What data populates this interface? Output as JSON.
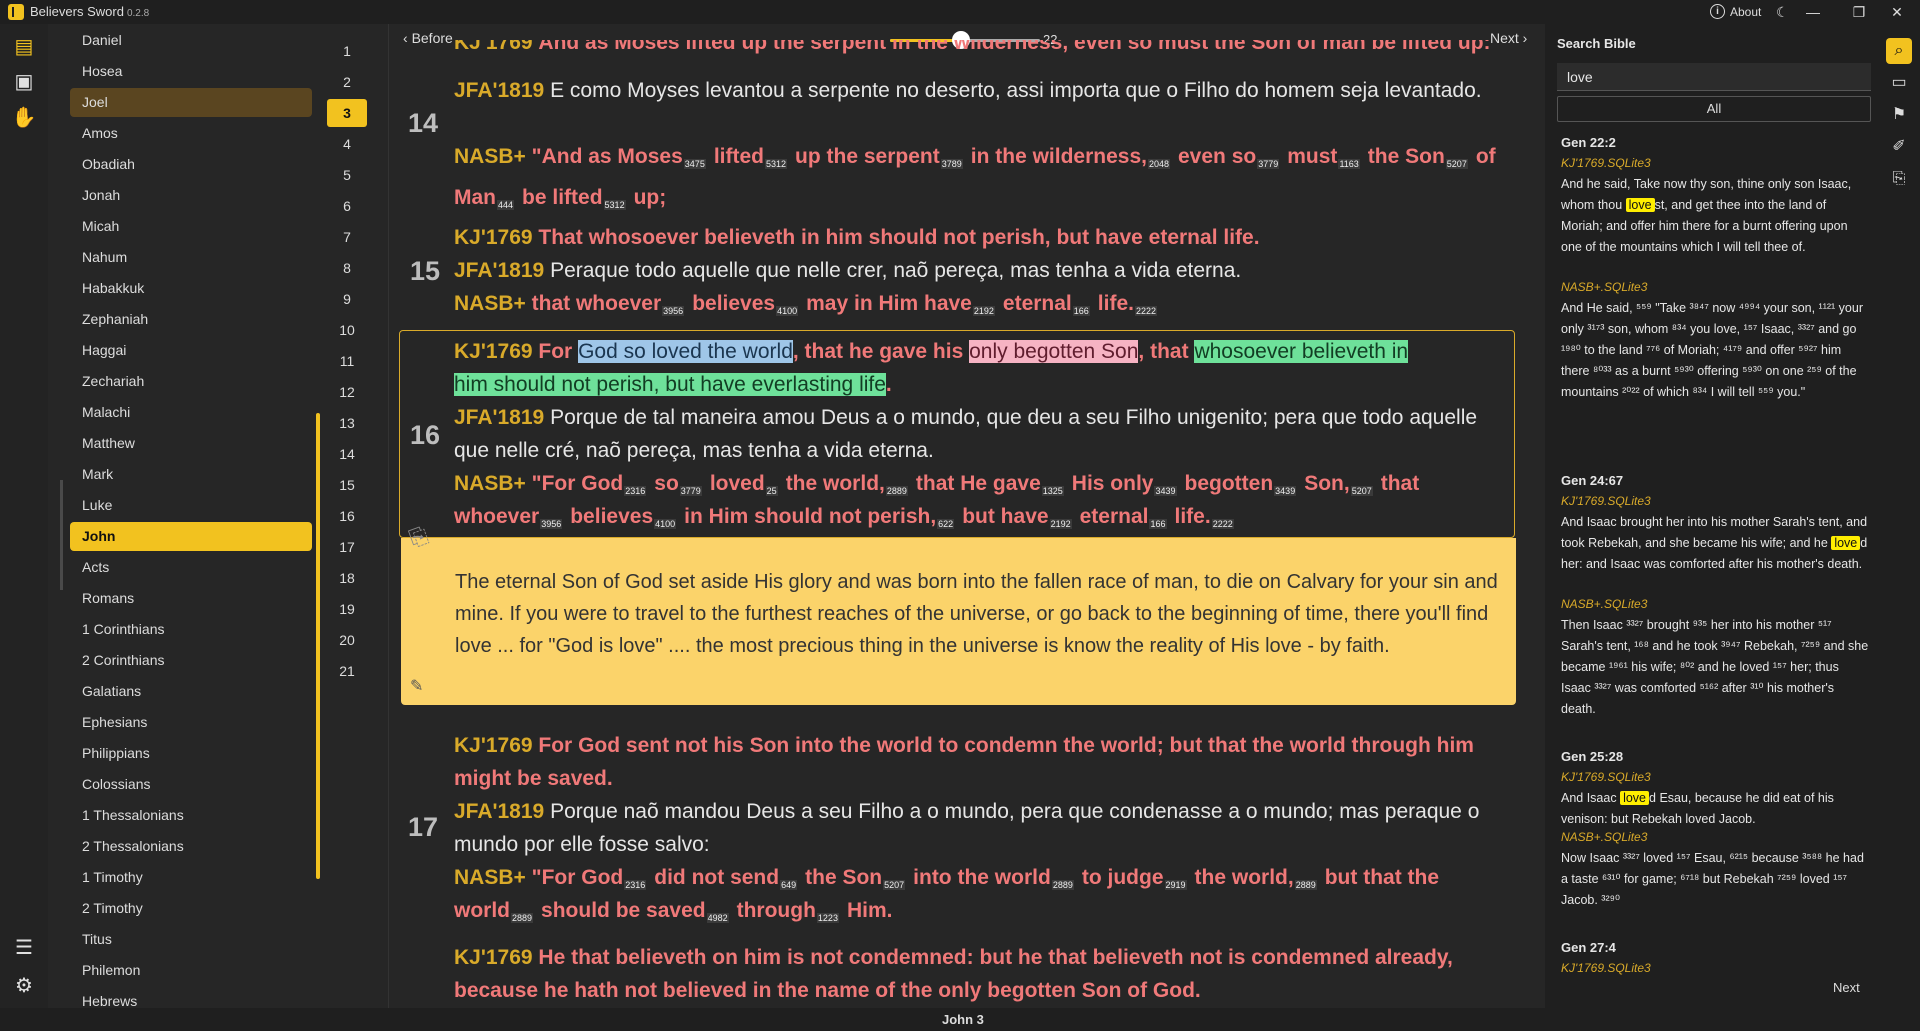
{
  "app": {
    "title": "Believers Sword",
    "version": "0.2.8",
    "about": "About",
    "window_buttons": [
      "—",
      "❐",
      "✕"
    ]
  },
  "books": [
    "Daniel",
    "Hosea",
    "Joel",
    "Amos",
    "Obadiah",
    "Jonah",
    "Micah",
    "Nahum",
    "Habakkuk",
    "Zephaniah",
    "Haggai",
    "Zechariah",
    "Malachi",
    "Matthew",
    "Mark",
    "Luke",
    "John",
    "Acts",
    "Romans",
    "1 Corinthians",
    "2 Corinthians",
    "Galatians",
    "Ephesians",
    "Philippians",
    "Colossians",
    "1 Thessalonians",
    "2 Thessalonians",
    "1 Timothy",
    "2 Timothy",
    "Titus",
    "Philemon",
    "Hebrews"
  ],
  "selected_book": "John",
  "hover_book": "Joel",
  "chapters": [
    "1",
    "2",
    "3",
    "4",
    "5",
    "6",
    "7",
    "8",
    "9",
    "10",
    "11",
    "12",
    "13",
    "14",
    "15",
    "16",
    "17",
    "18",
    "19",
    "20",
    "21"
  ],
  "selected_chapter": "3",
  "nav": {
    "before": "Before",
    "next": "Next",
    "font_size": "22",
    "font_size_level": 0.47
  },
  "verses": {
    "v14": {
      "num": "14",
      "kj_tag": "KJ'1769",
      "kj": "And as Moses lifted up the serpent in the wilderness, even so must the Son of man be lifted up:",
      "jfa_tag": "JFA'1819",
      "jfa": "E como Moyses levantou a serpente no deserto, assi importa que o Filho do homem seja levantado.",
      "nasb_tag": "NASB+",
      "nasb": [
        [
          "\"And as Moses",
          "3475"
        ],
        [
          "lifted",
          "5312"
        ],
        [
          "up the serpent",
          "3789"
        ],
        [
          "in the wilderness,",
          "2048"
        ],
        [
          "even so",
          "3779"
        ],
        [
          "must",
          "1163"
        ],
        [
          "the Son",
          "5207"
        ],
        [
          "of Man",
          "444"
        ],
        [
          "be lifted",
          "5312"
        ],
        [
          "up;",
          ""
        ]
      ]
    },
    "v15": {
      "num": "15",
      "kj_tag": "KJ'1769",
      "kj": "That whosoever believeth in him should not perish, but have eternal life.",
      "jfa_tag": "JFA'1819",
      "jfa": "Peraque todo aquelle que nelle crer, naõ pereça, mas tenha a vida eterna.",
      "nasb_tag": "NASB+",
      "nasb": [
        [
          "that whoever",
          "3956"
        ],
        [
          "believes",
          "4100"
        ],
        [
          "may in Him have",
          "2192"
        ],
        [
          "eternal",
          "166"
        ],
        [
          "life.",
          "2222"
        ]
      ]
    },
    "v16": {
      "num": "16",
      "kj_tag": "KJ'1769",
      "kj_pre": "For",
      "kj_hl1": "God so loved the world",
      "kj_mid1": ", that he gave his",
      "kj_hl2": "only begotten Son",
      "kj_mid2": ", that",
      "kj_hl3a": "whosoever believeth in",
      "kj_hl3b": "him should not perish, but have everlasting life",
      "kj_end": ".",
      "jfa_tag": "JFA'1819",
      "jfa": "Porque de tal maneira amou Deus a o mundo, que deu a seu Filho unigenito; pera que todo aquelle que nelle cré, naõ pereça, mas tenha a vida eterna.",
      "nasb_tag": "NASB+",
      "nasb_l1": [
        [
          "\"For God",
          "2316"
        ],
        [
          "so",
          "3779"
        ],
        [
          "loved",
          "25"
        ],
        [
          "the world,",
          "2889"
        ],
        [
          "that He gave",
          "1325"
        ],
        [
          "His only",
          "3439"
        ],
        [
          "begotten",
          "3439"
        ],
        [
          "Son,",
          "5207"
        ],
        [
          "that",
          ""
        ]
      ],
      "nasb_l2": [
        [
          "whoever",
          "3956"
        ],
        [
          "believes",
          "4100"
        ],
        [
          "in Him should not perish,",
          "622"
        ],
        [
          "but have",
          "2192"
        ],
        [
          "eternal",
          "166"
        ],
        [
          "life.",
          "2222"
        ]
      ],
      "note": "The eternal Son of God set aside His glory and was born into the fallen race of man, to die on Calvary for your sin and mine. If you were to travel to the furthest reaches of the universe, or go back to the beginning of time, there you'll find love ... for \"God is love\" .... the most precious thing in the universe is know the reality of His love - by faith."
    },
    "v17": {
      "num": "17",
      "kj_tag": "KJ'1769",
      "kj": "For God sent not his Son into the world to condemn the world; but that the world through him might be saved.",
      "jfa_tag": "JFA'1819",
      "jfa": "Porque naõ mandou Deus a seu Filho a o mundo, pera que condenasse a o mundo; mas peraque o mundo por elle fosse salvo:",
      "nasb_tag": "NASB+",
      "nasb_l1": [
        [
          "\"For God",
          "2316"
        ],
        [
          "did not send",
          "649"
        ],
        [
          "the Son",
          "5207"
        ],
        [
          "into the world",
          "2889"
        ],
        [
          "to judge",
          "2919"
        ],
        [
          "the world,",
          "2889"
        ],
        [
          "but that the",
          ""
        ]
      ],
      "nasb_l2": [
        [
          "world",
          "2889"
        ],
        [
          "should be saved",
          "4982"
        ],
        [
          "through",
          "1223"
        ],
        [
          "Him.",
          ""
        ]
      ]
    },
    "v18": {
      "kj_tag": "KJ'1769",
      "kj": "He that believeth on him is not condemned: but he that believeth not is condemned already, because he hath not believed in the name of the only begotten Son of God."
    }
  },
  "footer": {
    "label": "John 3"
  },
  "search": {
    "title": "Search Bible",
    "query": "love",
    "scope": "All",
    "next": "Next",
    "results": [
      {
        "ref": "Gen 22:2",
        "kj_src": "KJ'1769.SQLite3",
        "kj_pre": "And he said, Take now thy son, thine only son Isaac, whom thou",
        "kj_mark": "love",
        "kj_post": "st, and get thee into the land of Moriah; and offer him there for a burnt offering upon one of the mountains which I will tell thee of.",
        "nasb_src": "NASB+.SQLite3",
        "nasb": "And He said, ⁵⁵⁹ \"Take ³⁸⁴⁷ now ⁴⁹⁹⁴ your son, ¹¹²¹ your only ³¹⁷³ son, whom ⁸³⁴ you love, ¹⁵⁷ Isaac, ³³²⁷ and go ¹⁹⁸⁰ to the land ⁷⁷⁶ of Moriah; ⁴¹⁷⁹ and offer ⁵⁹²⁷ him there ⁸⁰³³ as a burnt ⁵⁹³⁰ offering ⁵⁹³⁰ on one ²⁵⁹ of the mountains ²⁰²² of which ⁸³⁴ I will tell ⁵⁵⁹ you.\""
      },
      {
        "ref": "Gen 24:67",
        "kj_src": "KJ'1769.SQLite3",
        "kj_pre": "And Isaac brought her into his mother Sarah's tent, and took Rebekah, and she became his wife; and he",
        "kj_mark": "love",
        "kj_post": "d her: and Isaac was comforted after his mother's death.",
        "nasb_src": "NASB+.SQLite3",
        "nasb": "Then Isaac ³³²⁷ brought ⁹³⁵ her into his mother ⁵¹⁷ Sarah's tent, ¹⁶⁸ and he took ³⁹⁴⁷ Rebekah, ⁷²⁵⁹ and she became ¹⁹⁶¹ his wife; ⁸⁰² and he loved ¹⁵⁷ her; thus Isaac ³³²⁷ was comforted ⁵¹⁶² after ³¹⁰ his mother's death."
      },
      {
        "ref": "Gen 25:28",
        "kj_src": "KJ'1769.SQLite3",
        "kj_pre": "And Isaac",
        "kj_mark": "love",
        "kj_post": "d Esau, because he did eat of his venison: but Rebekah loved Jacob.",
        "nasb_src": "NASB+.SQLite3",
        "nasb": "Now Isaac ³³²⁷ loved ¹⁵⁷ Esau, ⁶²¹⁵ because ³⁵⁸⁸ he had a taste ⁶³¹⁰ for game; ⁶⁷¹⁸ but Rebekah ⁷²⁵⁹ loved ¹⁵⁷ Jacob. ³²⁹⁰"
      },
      {
        "ref": "Gen 27:4",
        "kj_src": "KJ'1769.SQLite3"
      }
    ]
  },
  "icons": {
    "rail": [
      "read-bible-icon",
      "media-icon",
      "prayer-icon",
      "profile-list-icon",
      "settings-icon"
    ],
    "right_rail": [
      "search-icon",
      "notes-icon",
      "bookmark-icon",
      "highlight-icon",
      "clip-icon"
    ]
  },
  "colors": {
    "accent": "#f2c21f",
    "kj_text": "#f07979",
    "version_tag": "#d9aa2a",
    "note_bg": "#fbd36a",
    "hl_blue": "#9fc6e8",
    "hl_pink": "#f6b3c3",
    "hl_green": "#6ee19a",
    "search_mark": "#ffee00"
  }
}
